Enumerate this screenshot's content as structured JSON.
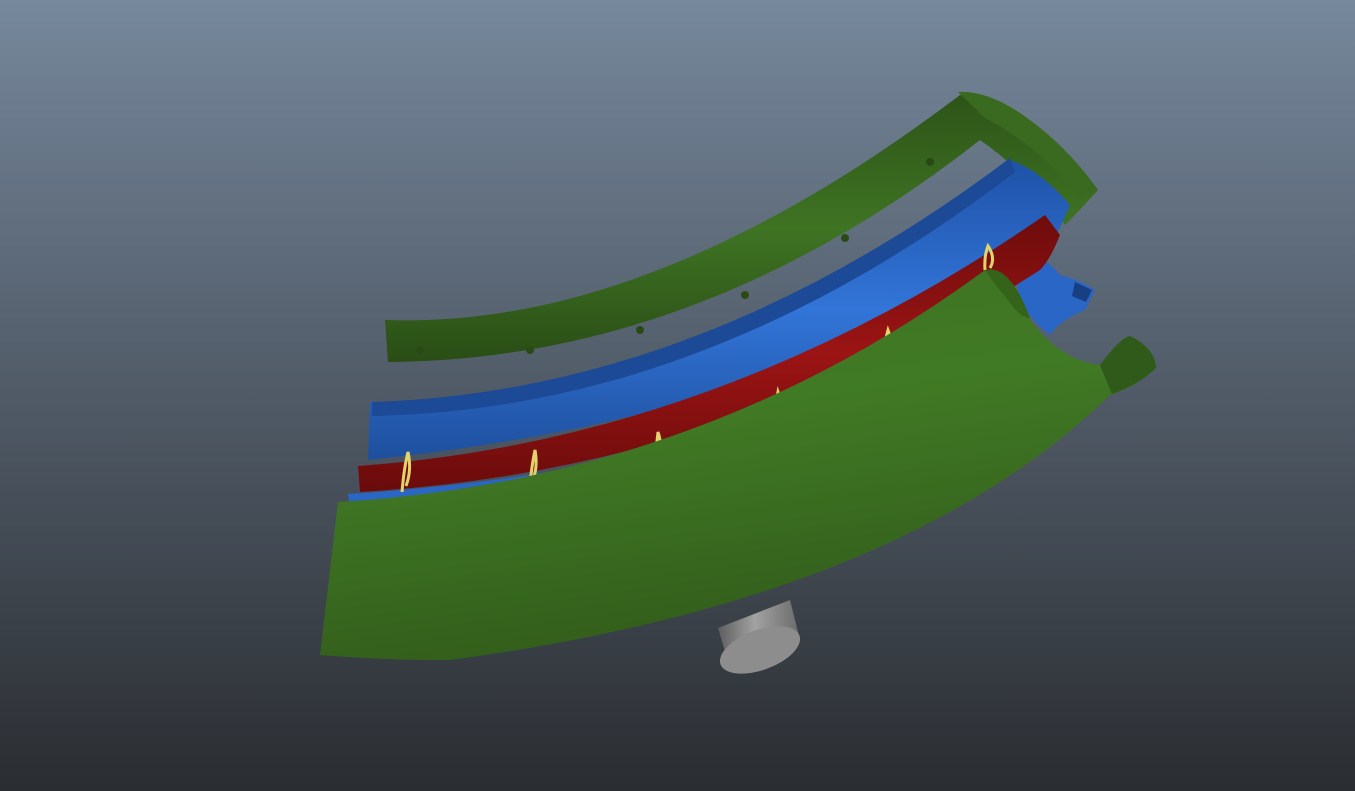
{
  "viewport": {
    "background_top": "#76889c",
    "background_bottom": "#2a2d31"
  },
  "model": {
    "parts": [
      {
        "name": "outer-shell",
        "color": "#3d7022"
      },
      {
        "name": "inner-liner",
        "color": "#2a66c6"
      },
      {
        "name": "heater-band",
        "color": "#8b1111"
      },
      {
        "name": "coil-clips",
        "color": "#e2d36a"
      },
      {
        "name": "support-pipe",
        "color": "#8a8a8a"
      }
    ]
  }
}
